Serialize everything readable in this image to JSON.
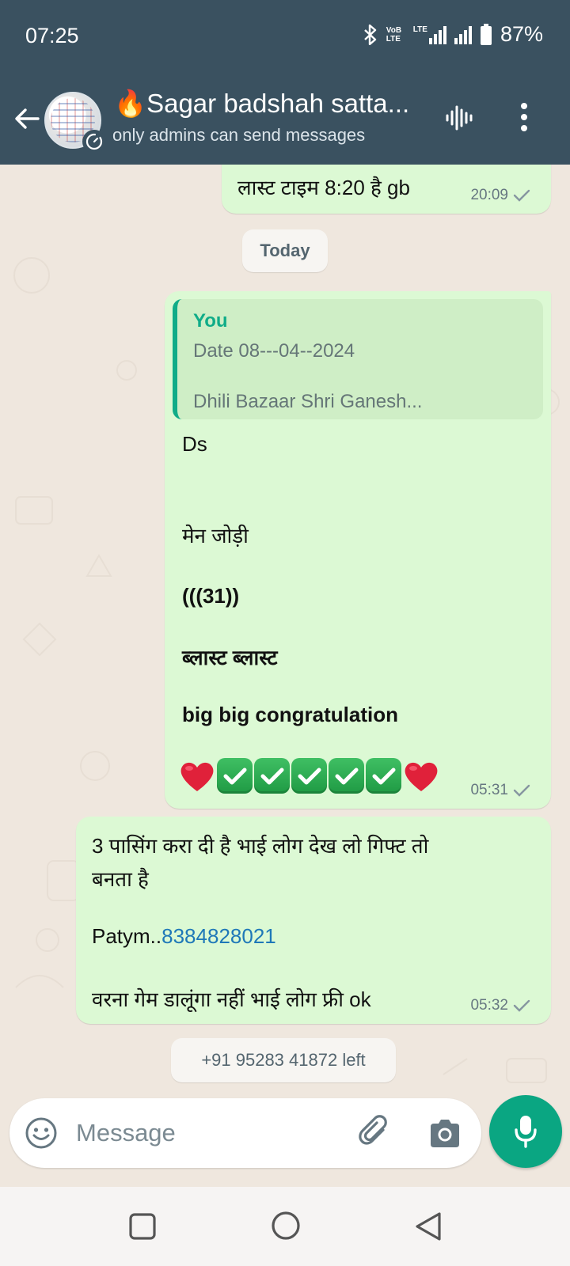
{
  "status_bar": {
    "time": "07:25",
    "network_label_1": "VoB LTE",
    "network_label_2": "LTE",
    "battery": "87%"
  },
  "header": {
    "title": "🔥Sagar badshah satta...",
    "subtitle": "only admins can send messages"
  },
  "messages": [
    {
      "text": "लास्ट टाइम 8:20 है gb",
      "time": "20:09"
    },
    {
      "date_chip": "Today"
    },
    {
      "quote": {
        "author": "You",
        "line1": "Date 08---04--2024",
        "line2": "Dhili Bazaar Shri Ganesh..."
      },
      "lines": [
        "Ds",
        "मेन जोड़ी",
        "(((31))",
        "ब्लास्ट ब्लास्ट",
        "big big congratulation"
      ],
      "emoji_row": [
        "heart",
        "check",
        "check",
        "check",
        "check",
        "check",
        "heart"
      ],
      "time": "05:31"
    },
    {
      "line1": "3 पासिंग करा दी है भाई लोग देख लो गिफ्ट तो",
      "line2": "बनता है",
      "patym_prefix": "Patym..",
      "phone_link": "8384828021",
      "line4": "वरना गेम डालूंगा नहीं भाई लोग फ्री ok",
      "time": "05:32"
    },
    {
      "system": "+91 95283 41872 left"
    }
  ],
  "composer": {
    "placeholder": "Message"
  },
  "colors": {
    "header_bg": "#3a5160",
    "chat_bg": "#efe7de",
    "outgoing_bubble": "#dcf9d4",
    "accent_green": "#0aa682",
    "link_blue": "#1e78b8"
  }
}
